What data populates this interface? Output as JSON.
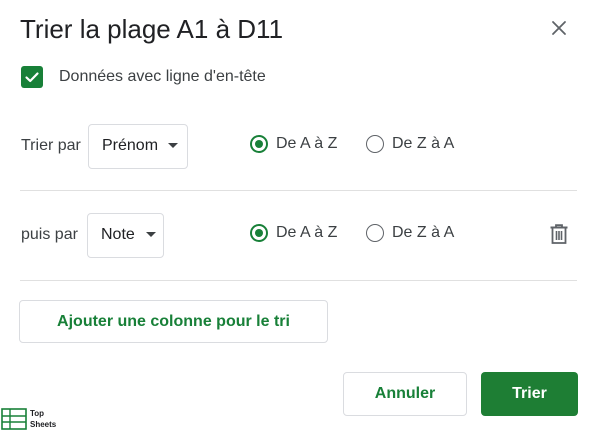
{
  "dialog": {
    "title": "Trier la plage A1 à D11",
    "close_icon": "close-icon"
  },
  "header_checkbox": {
    "checked": true,
    "label": "Données avec ligne d'en-tête"
  },
  "sort_rows": [
    {
      "label": "Trier par",
      "column": "Prénom",
      "options": [
        "De A à Z",
        "De Z à A"
      ],
      "selected": "De A à Z"
    },
    {
      "label": "puis par",
      "column": "Note",
      "options": [
        "De A à Z",
        "De Z à A"
      ],
      "selected": "De A à Z",
      "delete_icon": "trash-icon"
    }
  ],
  "add_column_label": "Ajouter une colonne pour le tri",
  "footer": {
    "cancel_label": "Annuler",
    "sort_label": "Trier"
  },
  "watermark": {
    "line1": "Top",
    "line2": "Sheets"
  },
  "colors": {
    "accent": "#188038",
    "primary_button": "#1e7e34",
    "border": "#dadce0",
    "divider": "#e0e0e0"
  }
}
